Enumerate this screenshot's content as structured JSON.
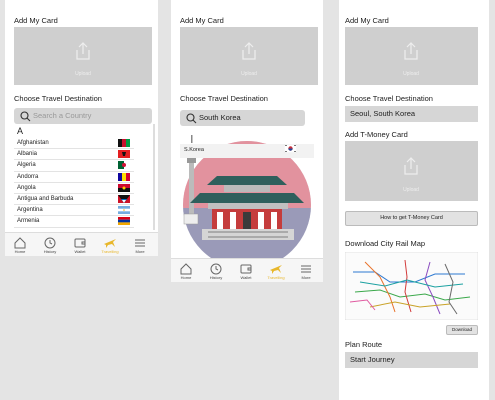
{
  "screen1": {
    "add_card": "Add My Card",
    "upload": "Upload",
    "choose_dest": "Choose Travel Destination",
    "search_placeholder": "Search a Country",
    "letter": "A",
    "countries": [
      {
        "name": "Afghanistan",
        "flag": "afghanistan"
      },
      {
        "name": "Albania",
        "flag": "albania"
      },
      {
        "name": "Algeria",
        "flag": "algeria"
      },
      {
        "name": "Andorra",
        "flag": "andorra"
      },
      {
        "name": "Angola",
        "flag": "angola"
      },
      {
        "name": "Antigua and Barbuda",
        "flag": "antigua"
      },
      {
        "name": "Argentina",
        "flag": "argentina"
      },
      {
        "name": "Armenia",
        "flag": "armenia"
      }
    ]
  },
  "screen2": {
    "add_card": "Add My Card",
    "upload": "Upload",
    "choose_dest": "Choose Travel Destination",
    "search_value": "South Korea",
    "country_label": "S.Korea"
  },
  "screen3": {
    "add_card": "Add My Card",
    "upload": "Upload",
    "choose_dest": "Choose Travel Destination",
    "destination": "Seoul, South Korea",
    "add_tmoney": "Add T-Money Card",
    "upload2": "Upload",
    "how_to": "How to get T-Money Card",
    "download_map": "Download City Rail Map",
    "download_btn": "Download",
    "plan_route": "Plan Route",
    "start_journey": "Start Journey"
  },
  "tabs": [
    {
      "label": "Home",
      "icon": "home-icon"
    },
    {
      "label": "History",
      "icon": "history-icon"
    },
    {
      "label": "Wallet",
      "icon": "wallet-icon"
    },
    {
      "label": "Travelling",
      "icon": "plane-icon"
    },
    {
      "label": "More",
      "icon": "menu-icon"
    }
  ],
  "colors": {
    "accent": "#e8b72b",
    "gray_box": "#cfcfcf",
    "background": "#e4e4e4"
  }
}
